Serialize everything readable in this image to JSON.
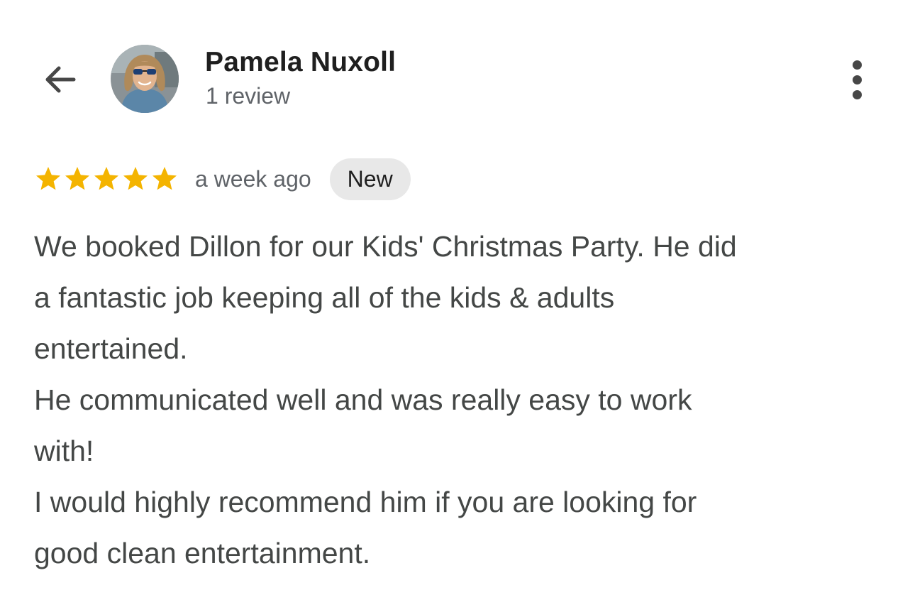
{
  "header": {
    "back_icon": "arrow-back-icon",
    "reviewer_name": "Pamela Nuxoll",
    "review_count": "1 review",
    "more_icon": "more-vertical-icon"
  },
  "review": {
    "rating": 5,
    "rating_max": 5,
    "star_color": "#f4b400",
    "date": "a week ago",
    "badge": "New",
    "lines": [
      "We booked Dillon for our Kids' Christmas Party. He did",
      "a fantastic job keeping all of the kids & adults",
      "entertained.",
      "He communicated well and was really easy to work",
      "with!",
      "I would highly recommend him if you are looking for",
      "good clean entertainment."
    ]
  },
  "colors": {
    "text_primary": "#1f1f1f",
    "text_secondary": "#5f6368",
    "body_text": "#444746",
    "badge_bg": "#e8e8e8"
  }
}
